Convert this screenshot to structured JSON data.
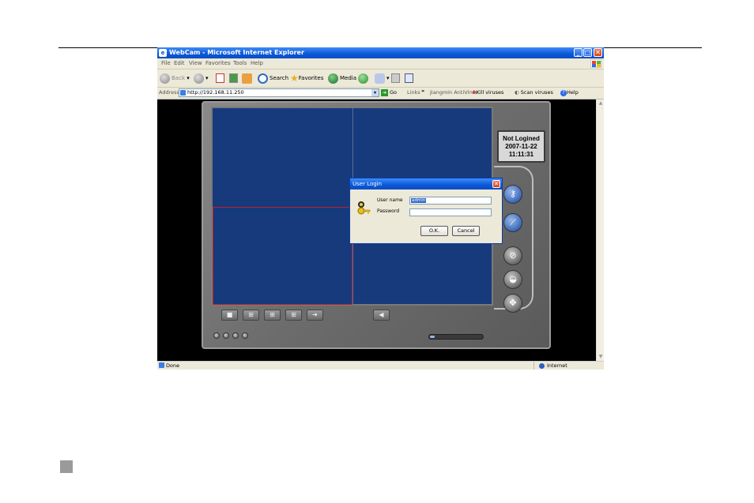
{
  "window": {
    "title": "WebCam - Microsoft Internet Explorer",
    "minimize": "_",
    "maximize": "□",
    "close": "✕"
  },
  "menu": [
    "File",
    "Edit",
    "View",
    "Favorites",
    "Tools",
    "Help"
  ],
  "toolbar": {
    "back": "Back",
    "search": "Search",
    "favorites": "Favorites",
    "media": "Media"
  },
  "address": {
    "label": "Address",
    "url": "http://192.168.11.250",
    "go": "Go",
    "links": "Links",
    "chevron": "»",
    "antivirus": "Jiangmin AntiVirus",
    "kill_viruses": "Kill viruses",
    "scan_viruses": "Scan viruses",
    "help": "Help"
  },
  "status": {
    "text": "Done",
    "zone": "Internet"
  },
  "dvr": {
    "status_line1": "Not Logined",
    "date": "2007-11-22",
    "time": "11:11:31"
  },
  "dialog": {
    "title": "User Login",
    "close": "✕",
    "username_label": "User name",
    "username_value": "admin",
    "password_label": "Password",
    "ok": "O.K.",
    "cancel": "Cancel"
  },
  "colors": {
    "xp_blue": "#0a57d8",
    "video_bg": "#163a7c",
    "selected_cell": "#c0202a"
  }
}
